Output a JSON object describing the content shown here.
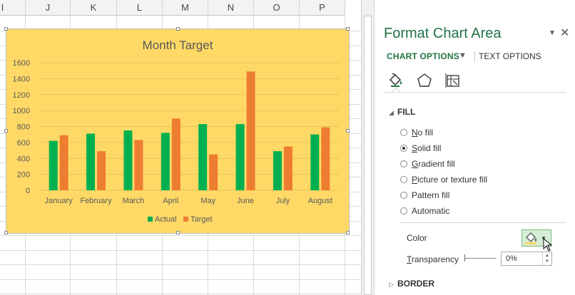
{
  "sheet": {
    "columns": [
      "I",
      "J",
      "K",
      "L",
      "M",
      "N",
      "O",
      "P"
    ]
  },
  "chart_data": {
    "type": "bar",
    "title": "Month Target",
    "categories": [
      "January",
      "February",
      "March",
      "April",
      "May",
      "June",
      "July",
      "August"
    ],
    "series": [
      {
        "name": "Actual",
        "color": "#00b050",
        "values": [
          620,
          710,
          750,
          720,
          830,
          830,
          490,
          700
        ]
      },
      {
        "name": "Target",
        "color": "#ed7d31",
        "values": [
          690,
          490,
          630,
          900,
          450,
          1490,
          550,
          790
        ]
      }
    ],
    "ylim": [
      0,
      1600
    ],
    "yticks": [
      0,
      200,
      400,
      600,
      800,
      1000,
      1200,
      1400,
      1600
    ],
    "grid": true,
    "legend": "bottom",
    "background": "#ffd966"
  },
  "pane": {
    "title": "Format Chart Area",
    "tabs": {
      "chart_options": "CHART OPTIONS",
      "text_options": "TEXT OPTIONS"
    },
    "icons": [
      "fill-line-icon",
      "effects-icon",
      "size-properties-icon"
    ],
    "fill_section": "FILL",
    "fill_options": [
      {
        "accel": "N",
        "rest": "o fill",
        "selected": false
      },
      {
        "accel": "S",
        "rest": "olid fill",
        "selected": true
      },
      {
        "accel": "G",
        "rest": "radient fill",
        "selected": false
      },
      {
        "accel": "P",
        "rest": "icture or texture fill",
        "selected": false
      },
      {
        "accel": "",
        "rest": "Pattern fill",
        "selected": false
      },
      {
        "accel": "",
        "rest": "Automatic",
        "selected": false
      }
    ],
    "color_label": "Color",
    "transparency_accel": "T",
    "transparency_rest": "ransparency",
    "transparency_value": "0%",
    "border_section": "BORDER",
    "accent": "#217346"
  }
}
